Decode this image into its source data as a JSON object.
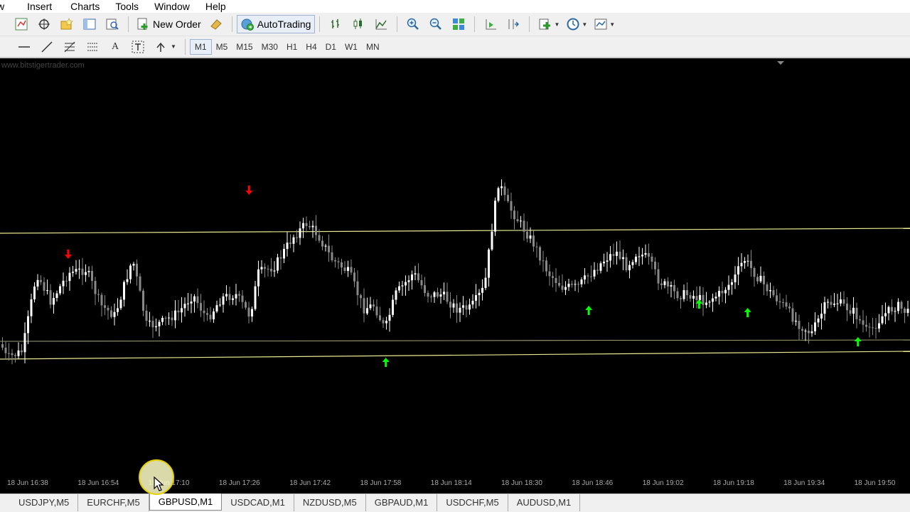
{
  "menu": [
    "w",
    "Insert",
    "Charts",
    "Tools",
    "Window",
    "Help"
  ],
  "toolbar": {
    "new_order": "New Order",
    "autotrading": "AutoTrading"
  },
  "timeframes": [
    "M1",
    "M5",
    "M15",
    "M30",
    "H1",
    "H4",
    "D1",
    "W1",
    "MN"
  ],
  "active_timeframe": "M1",
  "watermark": "www.bitstigertrader.com",
  "chart_data": {
    "type": "candlestick",
    "symbol": "GBPUSD",
    "timeframe": "M1",
    "x_tick_labels": [
      "18 Jun 16:38",
      "18 Jun 16:54",
      "18 Jun 17:10",
      "18 Jun 17:26",
      "18 Jun 17:42",
      "18 Jun 17:58",
      "18 Jun 18:14",
      "18 Jun 18:30",
      "18 Jun 18:46",
      "18 Jun 19:02",
      "18 Jun 19:18",
      "18 Jun 19:34",
      "18 Jun 19:50"
    ],
    "signals": {
      "sell_arrows_minutes": [
        9,
        50
      ],
      "buy_arrows_minutes": [
        81,
        127,
        152,
        163,
        188
      ]
    },
    "lines": {
      "upper_channel_color": "#e8e890",
      "lower_channel_color": "#e8e890",
      "mid_line_color": "#cccc99"
    },
    "colors": {
      "bull": "#ffffff",
      "bear": "#888888",
      "sell_arrow": "#ff0000",
      "buy_arrow": "#00ff00"
    }
  },
  "tabs": [
    "USDJPY,M5",
    "EURCHF,M5",
    "GBPUSD,M1",
    "USDCAD,M1",
    "NZDUSD,M5",
    "GBPAUD,M1",
    "USDCHF,M5",
    "AUDUSD,M1"
  ],
  "active_tab": "GBPUSD,M1"
}
